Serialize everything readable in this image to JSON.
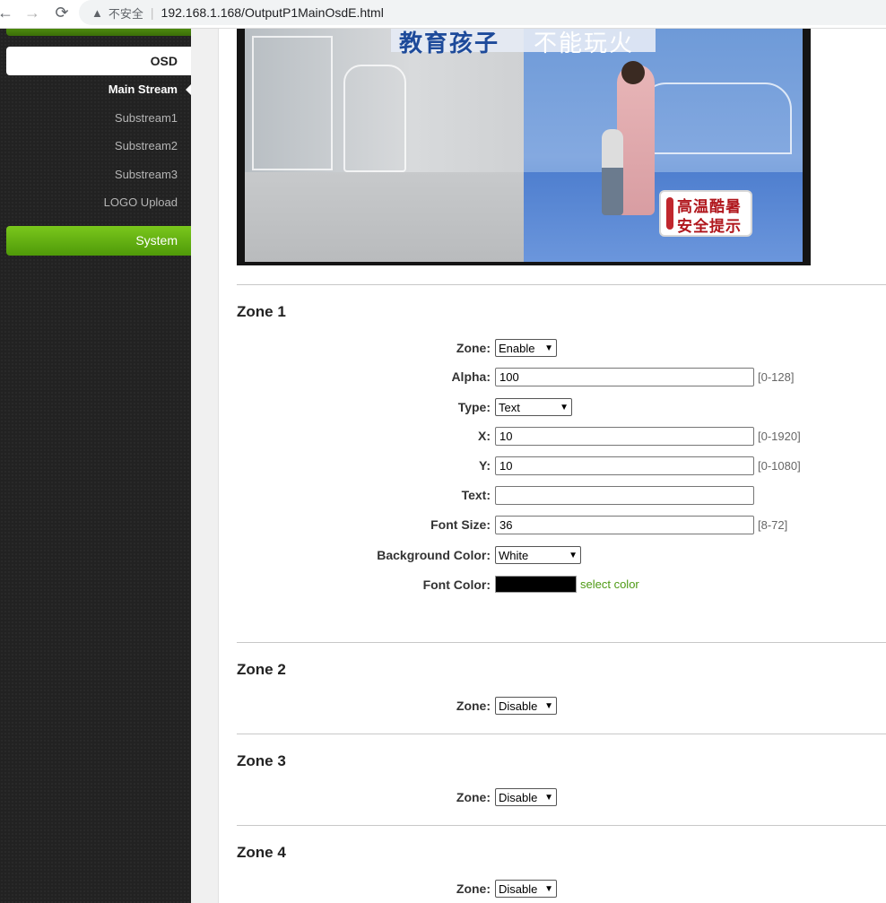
{
  "browser": {
    "back_icon": "←",
    "forward_icon": "→",
    "reload_icon": "⟳",
    "warning_icon": "▲",
    "insecure_label": "不安全",
    "url": "192.168.1.168/OutputP1MainOsdE.html"
  },
  "sidebar": {
    "tab_osd": "OSD",
    "items": [
      {
        "label": "Main Stream",
        "active": true
      },
      {
        "label": "Substream1",
        "active": false
      },
      {
        "label": "Substream2",
        "active": false
      },
      {
        "label": "Substream3",
        "active": false
      },
      {
        "label": "LOGO Upload",
        "active": false
      }
    ],
    "system_label": "System"
  },
  "video": {
    "caption_main": "教育孩子",
    "caption_rest": "不能玩火",
    "sign_line1": "高温酷暑",
    "sign_line2": "安全提示"
  },
  "zone1": {
    "title": "Zone 1",
    "zone_label": "Zone:",
    "zone_value": "Enable",
    "alpha_label": "Alpha:",
    "alpha_value": "100",
    "alpha_hint": "[0-128]",
    "type_label": "Type:",
    "type_value": "Text",
    "x_label": "X:",
    "x_value": "10",
    "x_hint": "[0-1920]",
    "y_label": "Y:",
    "y_value": "10",
    "y_hint": "[0-1080]",
    "text_label": "Text:",
    "text_value": "",
    "font_size_label": "Font Size:",
    "font_size_value": "36",
    "font_size_hint": "[8-72]",
    "bg_color_label": "Background Color:",
    "bg_color_value": "White",
    "font_color_label": "Font Color:",
    "font_color_swatch": "#000000",
    "select_color": "select color"
  },
  "zone2": {
    "title": "Zone 2",
    "zone_label": "Zone:",
    "zone_value": "Disable"
  },
  "zone3": {
    "title": "Zone 3",
    "zone_label": "Zone:",
    "zone_value": "Disable"
  },
  "zone4": {
    "title": "Zone 4",
    "zone_label": "Zone:",
    "zone_value": "Disable"
  },
  "colors": {
    "accent_green": "#5ea90e",
    "link_green": "#4e9a14",
    "sidebar_bg": "#222222"
  }
}
